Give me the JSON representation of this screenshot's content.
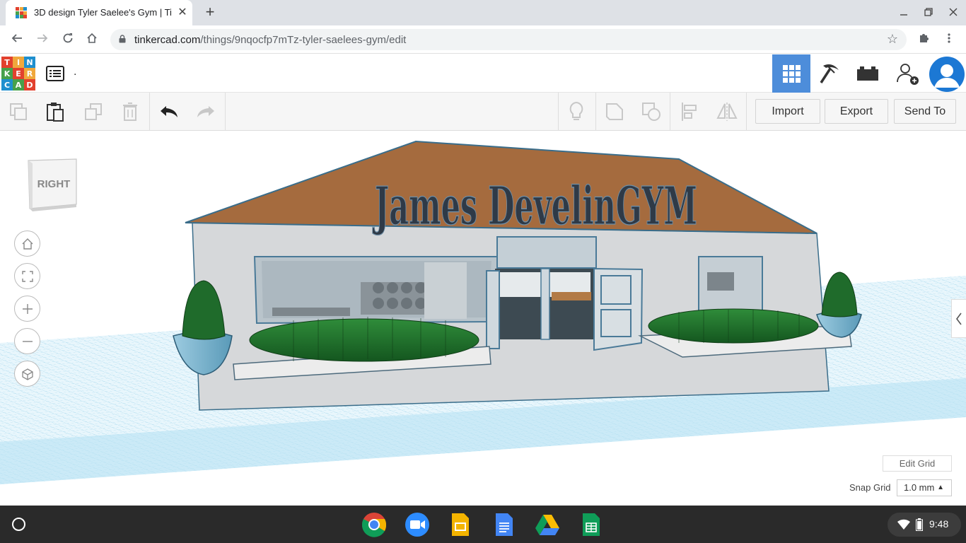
{
  "browser": {
    "tab_title": "3D design Tyler Saelee's Gym | Ti",
    "new_tab": "+",
    "close": "✕",
    "url_domain": "tinkercad.com",
    "url_path": "/things/9nqocfp7mTz-tyler-saelees-gym/edit"
  },
  "logo": {
    "letters": [
      "T",
      "I",
      "N",
      "K",
      "E",
      "R",
      "C",
      "A",
      "D"
    ]
  },
  "app": {
    "design_name": "."
  },
  "toolbar": {
    "import": "Import",
    "export": "Export",
    "send_to": "Send To"
  },
  "workplane": {
    "viewcube_face": "RIGHT",
    "sign_text": "James DevelinGYM",
    "edit_grid": "Edit Grid",
    "snap_grid_label": "Snap Grid",
    "snap_grid_value": "1.0 mm"
  },
  "shelf": {
    "clock": "9:48"
  },
  "colors": {
    "accent": "#4d8dda",
    "roof": "#a36a3f",
    "wall": "#d8dadb",
    "hedge": "#1e6b2a",
    "planter": "#7cb7cf",
    "grid": "#9fd4ec"
  }
}
